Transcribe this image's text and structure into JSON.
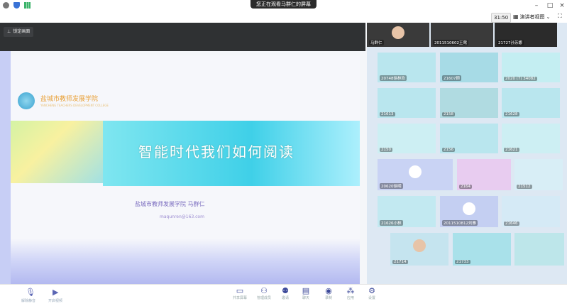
{
  "top": {
    "share_banner": "您正在观看马群仁的屏幕",
    "timer": "31:50",
    "view_label": "演讲者视图",
    "view_caret": "⌄"
  },
  "pin": {
    "label": "锁定画面"
  },
  "slide": {
    "college": "盐城市教师发展学院",
    "college_sub": "YANCHENG TEACHERS DEVELOPMENT COLLEGE",
    "title": "智能时代我们如何阅读",
    "author": "盐城市教师发展学院  马群仁",
    "email": "maqunren@163.com"
  },
  "participants": [
    {
      "label": "马群仁"
    },
    {
      "label": "2011510602王莺"
    },
    {
      "label": "21727孙苏娜"
    },
    {
      "label": "20748徐林欢"
    },
    {
      "label": "21607顾"
    },
    {
      "label": "2020 (7) 34082"
    },
    {
      "label": "21613"
    },
    {
      "label": "2158"
    },
    {
      "label": "21628"
    },
    {
      "label": "2150"
    },
    {
      "label": "2156"
    },
    {
      "label": "21621"
    },
    {
      "label": "20620徐明"
    },
    {
      "label": "2164"
    },
    {
      "label": "21512"
    },
    {
      "label": "21626小林"
    },
    {
      "label": "2011510812刘雅"
    },
    {
      "label": "21646"
    },
    {
      "label": "21714"
    },
    {
      "label": "21733"
    }
  ],
  "bottombar": {
    "mic": "解除静音",
    "cam": "开启视频",
    "items": [
      {
        "icon": "▭",
        "label": "共享屏幕"
      },
      {
        "icon": "⚇",
        "label": "管理成员"
      },
      {
        "icon": "⚉",
        "label": "邀请"
      },
      {
        "icon": "▤",
        "label": "聊天"
      },
      {
        "icon": "◉",
        "label": "录制"
      },
      {
        "icon": "⁂",
        "label": "应用"
      },
      {
        "icon": "⚙",
        "label": "设置"
      }
    ]
  }
}
